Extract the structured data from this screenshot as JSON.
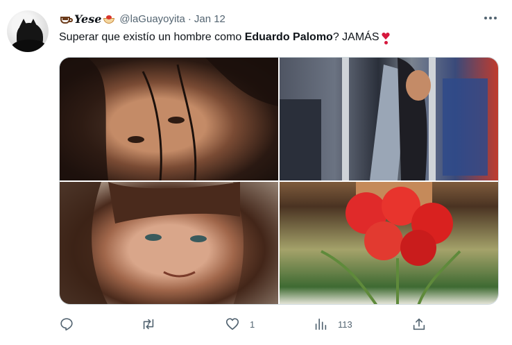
{
  "tweet": {
    "author": {
      "display_name": "Yese",
      "handle": "@laGuayoyita",
      "separator": "·",
      "date": "Jan 12",
      "name_emojis": [
        "coffee-cup-icon",
        "pasta-icon"
      ]
    },
    "text": {
      "before": "Superar que existío un hombre como ",
      "bold": "Eduardo Palomo",
      "after": "? JAMÁS",
      "trailing_emoji": "heart-exclamation-icon"
    },
    "media": {
      "count": 4
    },
    "actions": {
      "reply": {
        "icon": "reply-icon",
        "count": ""
      },
      "retweet": {
        "icon": "retweet-icon",
        "count": ""
      },
      "like": {
        "icon": "heart-icon",
        "count": "1"
      },
      "views": {
        "icon": "views-icon",
        "count": "113"
      },
      "share": {
        "icon": "share-icon",
        "count": ""
      }
    }
  },
  "colors": {
    "text": "#0f1419",
    "secondary": "#536471",
    "border": "#cfd9de",
    "heart": "#d6183d"
  }
}
